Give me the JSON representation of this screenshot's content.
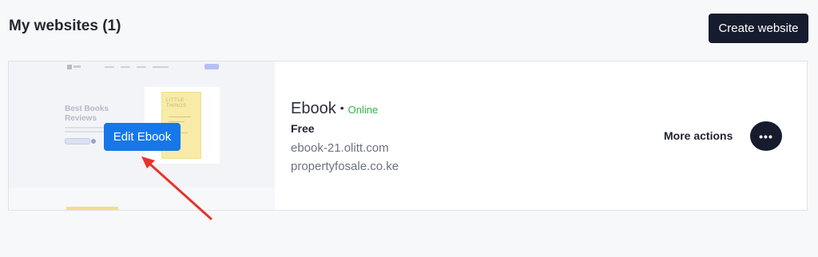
{
  "header": {
    "title": "My websites (1)",
    "create_button_label": "Create website"
  },
  "websites": [
    {
      "preview": {
        "heading_line1": "Best Books",
        "heading_line2": "Reviews",
        "book_cover_line1": "LITTLE",
        "book_cover_line2": "THINGS"
      },
      "edit_button_label": "Edit Ebook",
      "name": "Ebook",
      "separator": "•",
      "status": "Online",
      "plan": "Free",
      "subdomain": "ebook-21.olitt.com",
      "custom_domain": "propertyfosale.co.ke",
      "more_actions_label": "More actions",
      "more_button_glyph": "•••"
    }
  ],
  "colors": {
    "primary_dark": "#171b2e",
    "edit_blue": "#1677e8",
    "status_online": "#2fb344",
    "annotation_arrow": "#e8322b"
  },
  "icons": {
    "more": "ellipsis-icon",
    "annotation": "red-arrow-annotation"
  }
}
